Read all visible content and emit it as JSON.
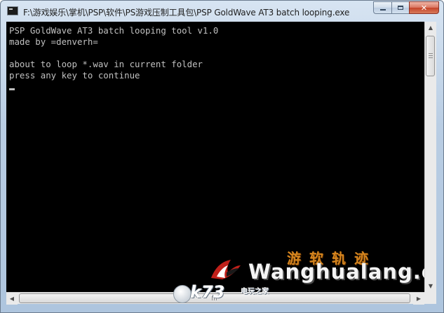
{
  "window": {
    "title": "F:\\游戏娱乐\\掌机\\PSP\\软件\\PS游戏压制工具包\\PSP GoldWave AT3 batch looping.exe",
    "icon": "console-window-icon"
  },
  "caption_buttons": {
    "minimize": "minimize-icon",
    "maximize": "maximize-icon",
    "close_label": "✕"
  },
  "console": {
    "lines": [
      "PSP GoldWave AT3 batch looping tool v1.0",
      "made by =denverh=",
      "",
      "about to loop *.wav in current folder",
      "press any key to continue"
    ],
    "text_color": "#c0c0c0",
    "background": "#000000"
  },
  "scrollbars": {
    "up_arrow": "▲",
    "down_arrow": "▼",
    "left_arrow": "◀",
    "right_arrow": "▶"
  },
  "watermark": {
    "chinese_text": "游软轨迹",
    "english_text": "Wanghualang.coM",
    "site_logo_text": "k73",
    "site_logo_sub": "电玩之家"
  },
  "colors": {
    "titlebar": "#b9cde3",
    "close_button": "#c5442a",
    "watermark_orange": "#d5851e"
  }
}
